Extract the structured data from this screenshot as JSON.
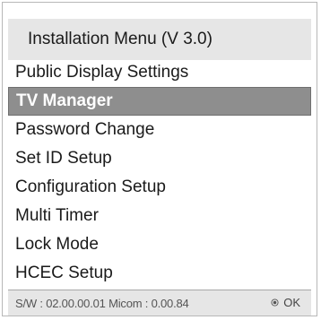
{
  "menu": {
    "title": "Installation Menu (V 3.0)",
    "items": [
      {
        "label": "Public Display Settings",
        "selected": false
      },
      {
        "label": "TV Manager",
        "selected": true
      },
      {
        "label": "Password Change",
        "selected": false
      },
      {
        "label": "Set ID Setup",
        "selected": false
      },
      {
        "label": "Configuration Setup",
        "selected": false
      },
      {
        "label": "Multi Timer",
        "selected": false
      },
      {
        "label": "Lock Mode",
        "selected": false
      },
      {
        "label": "HCEC Setup",
        "selected": false
      }
    ]
  },
  "footer": {
    "version": "S/W : 02.00.00.01 Micom : 0.00.84",
    "ok_label": "OK",
    "ok_icon": "ok-button-icon"
  },
  "colors": {
    "selected_bg": "#8e8e8e",
    "panel_bg": "#e6e6e6"
  }
}
